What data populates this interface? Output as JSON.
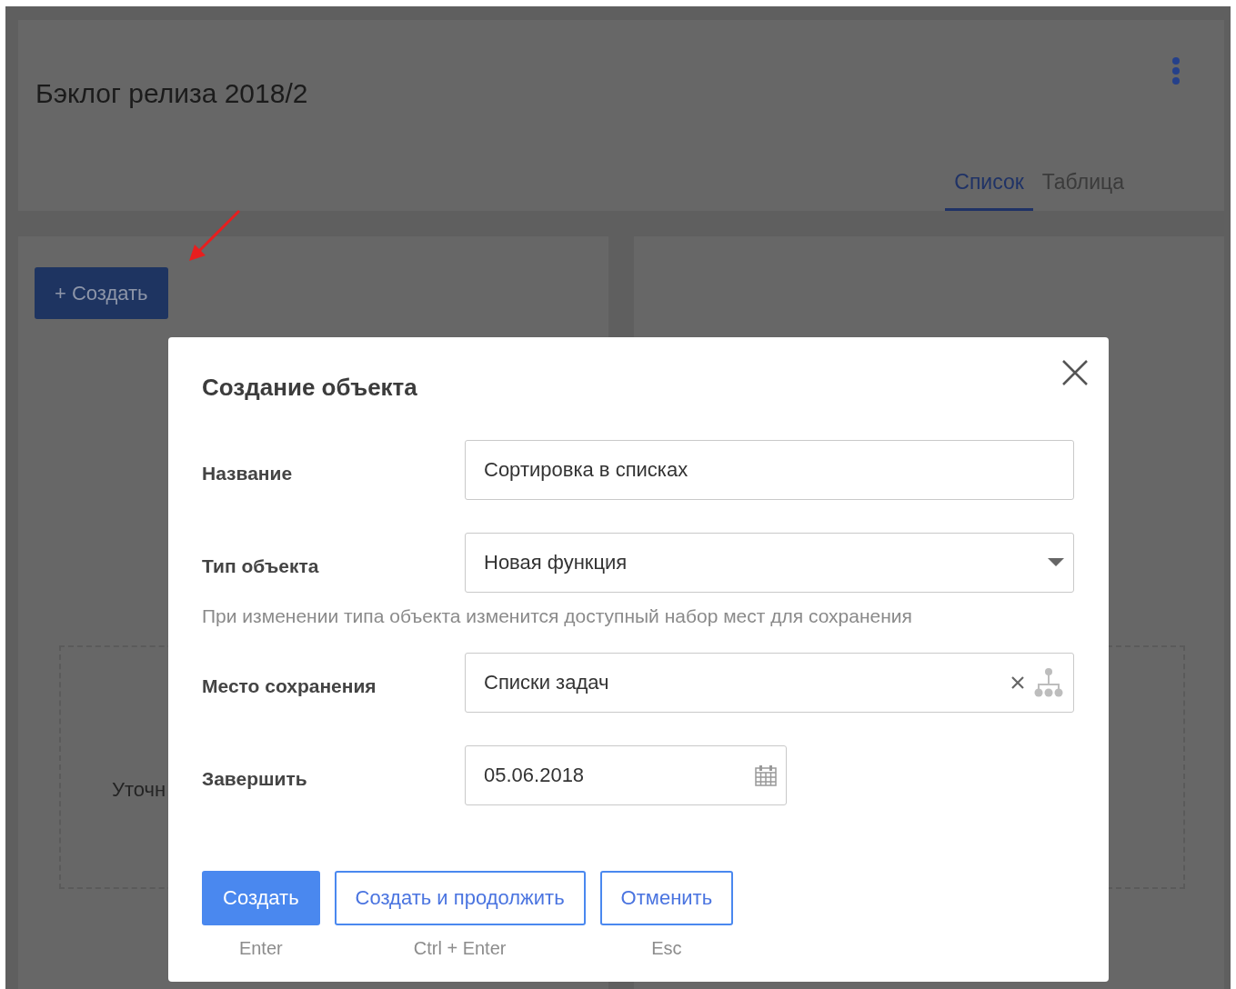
{
  "page": {
    "title": "Бэклог релиза 2018/2",
    "tabs": [
      {
        "label": "Список",
        "selected": true
      },
      {
        "label": "Таблица",
        "selected": false
      }
    ],
    "create_button": "+ Создать",
    "card_text": "Уточн"
  },
  "dialog": {
    "title": "Создание объекта",
    "fields": [
      {
        "kind": "text",
        "label": "Название",
        "value": "Сортировка в списках"
      },
      {
        "kind": "select",
        "label": "Тип объекта",
        "value": "Новая функция",
        "hint": "При изменении типа объекта изменится доступный набор мест для сохранения"
      },
      {
        "kind": "picker",
        "label": "Место сохранения",
        "value": "Списки задач"
      },
      {
        "kind": "date",
        "label": "Завершить",
        "value": "05.06.2018"
      }
    ],
    "buttons": [
      {
        "kind": "primary",
        "label": "Создать",
        "shortcut": "Enter"
      },
      {
        "kind": "outline",
        "label": "Создать и продолжить",
        "shortcut": "Ctrl + Enter"
      },
      {
        "kind": "outline",
        "label": "Отменить",
        "shortcut": "Esc"
      }
    ]
  }
}
